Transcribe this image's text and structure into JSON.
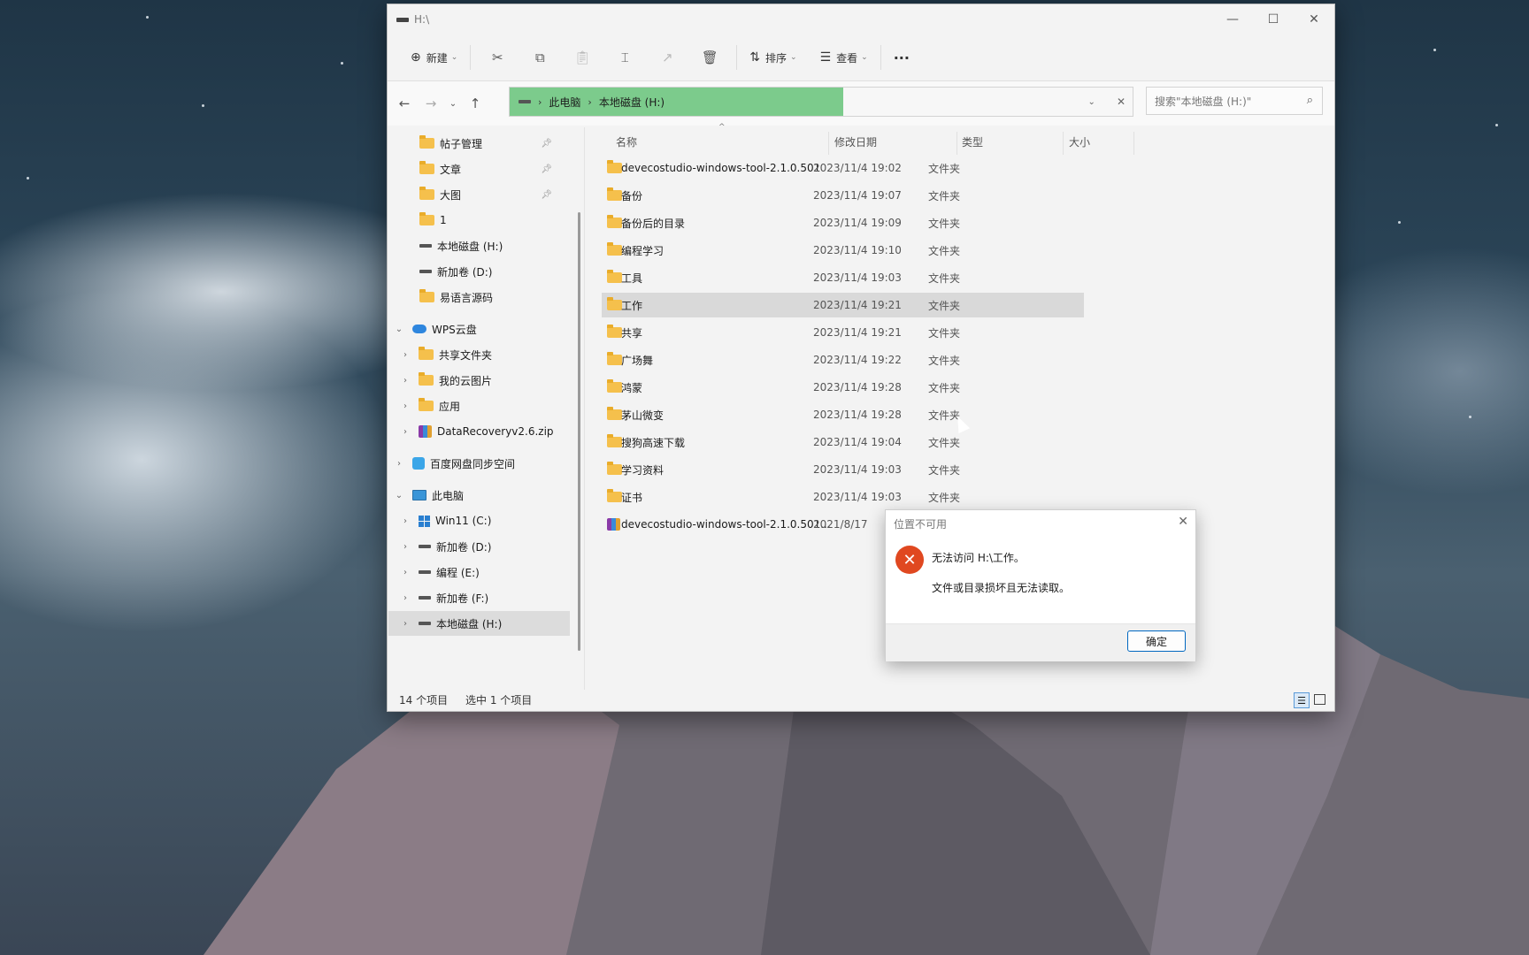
{
  "window": {
    "title": "H:\\"
  },
  "toolbar": {
    "new_label": "新建",
    "sort_label": "排序",
    "view_label": "查看",
    "more_label": "···"
  },
  "address": {
    "parts": [
      "此电脑",
      "本地磁盘 (H:)"
    ]
  },
  "search": {
    "placeholder": "搜索\"本地磁盘 (H:)\""
  },
  "sidebar": {
    "quick": [
      {
        "label": "帖子管理",
        "icon": "folder-icon",
        "pinned": true
      },
      {
        "label": "文章",
        "icon": "folder-icon",
        "pinned": true
      },
      {
        "label": "大图",
        "icon": "folder-icon",
        "pinned": true
      },
      {
        "label": "1",
        "icon": "folder-icon",
        "pinned": false
      },
      {
        "label": "本地磁盘 (H:)",
        "icon": "drive-icon",
        "pinned": false
      },
      {
        "label": "新加卷 (D:)",
        "icon": "drive-icon",
        "pinned": false
      },
      {
        "label": "易语言源码",
        "icon": "folder-icon",
        "pinned": false
      }
    ],
    "wps": {
      "label": "WPS云盘",
      "children": [
        "共享文件夹",
        "我的云图片",
        "应用",
        "DataRecoveryv2.6.zip"
      ]
    },
    "baidu": {
      "label": "百度网盘同步空间"
    },
    "pc": {
      "label": "此电脑",
      "children": [
        "Win11 (C:)",
        "新加卷 (D:)",
        "编程 (E:)",
        "新加卷 (F:)",
        "本地磁盘 (H:)"
      ]
    }
  },
  "columns": {
    "name": "名称",
    "date": "修改日期",
    "type": "类型",
    "size": "大小"
  },
  "files": [
    {
      "name": "devecostudio-windows-tool-2.1.0.501",
      "date": "2023/11/4 19:02",
      "type": "文件夹"
    },
    {
      "name": "备份",
      "date": "2023/11/4 19:07",
      "type": "文件夹"
    },
    {
      "name": "备份后的目录",
      "date": "2023/11/4 19:09",
      "type": "文件夹"
    },
    {
      "name": "编程学习",
      "date": "2023/11/4 19:10",
      "type": "文件夹"
    },
    {
      "name": "工具",
      "date": "2023/11/4 19:03",
      "type": "文件夹"
    },
    {
      "name": "工作",
      "date": "2023/11/4 19:21",
      "type": "文件夹"
    },
    {
      "name": "共享",
      "date": "2023/11/4 19:21",
      "type": "文件夹"
    },
    {
      "name": "广场舞",
      "date": "2023/11/4 19:22",
      "type": "文件夹"
    },
    {
      "name": "鸿蒙",
      "date": "2023/11/4 19:28",
      "type": "文件夹"
    },
    {
      "name": "茅山微变",
      "date": "2023/11/4 19:28",
      "type": "文件夹"
    },
    {
      "name": "搜狗高速下载",
      "date": "2023/11/4 19:04",
      "type": "文件夹"
    },
    {
      "name": "学习资料",
      "date": "2023/11/4 19:03",
      "type": "文件夹"
    },
    {
      "name": "证书",
      "date": "2023/11/4 19:03",
      "type": "文件夹"
    },
    {
      "name": "devecostudio-windows-tool-2.1.0.501...",
      "date": "2021/8/17",
      "type": ""
    }
  ],
  "selected_file": "工作",
  "status": {
    "count": "14 个项目",
    "selection": "选中 1 个项目"
  },
  "dialog": {
    "title": "位置不可用",
    "message1": "无法访问 H:\\工作。",
    "message2": "文件或目录损坏且无法读取。",
    "ok_label": "确定"
  },
  "colors": {
    "address_highlight": "#7ccb8c",
    "error": "#e04820",
    "folder": "#f5c04c"
  }
}
